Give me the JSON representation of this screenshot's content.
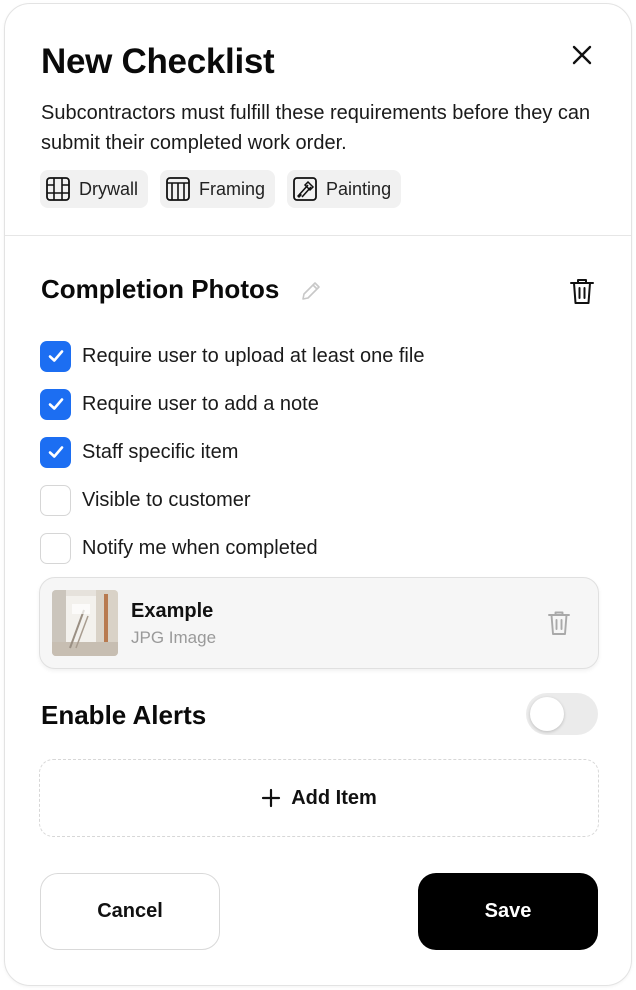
{
  "header": {
    "title": "New Checklist",
    "subtitle": "Subcontractors must fulfill these requirements before they can submit their completed work order.",
    "close_icon": "close-icon"
  },
  "tags": [
    {
      "label": "Drywall",
      "icon": "drywall-icon"
    },
    {
      "label": "Framing",
      "icon": "framing-icon"
    },
    {
      "label": "Painting",
      "icon": "painting-icon"
    }
  ],
  "section": {
    "title": "Completion Photos",
    "edit_icon": "pencil-icon",
    "delete_icon": "trash-icon",
    "options": [
      {
        "label": "Require user to upload at least one file",
        "checked": true
      },
      {
        "label": "Require user to add a note",
        "checked": true
      },
      {
        "label": "Staff specific item",
        "checked": true
      },
      {
        "label": "Visible to customer",
        "checked": false
      },
      {
        "label": "Notify me when completed",
        "checked": false
      }
    ]
  },
  "file": {
    "name": "Example",
    "type": "JPG Image"
  },
  "alerts": {
    "label": "Enable Alerts",
    "enabled": false
  },
  "add_item": {
    "label": "Add Item"
  },
  "footer": {
    "cancel_label": "Cancel",
    "save_label": "Save"
  },
  "colors": {
    "accent": "#1c6ef2",
    "primary_button": "#000000"
  }
}
